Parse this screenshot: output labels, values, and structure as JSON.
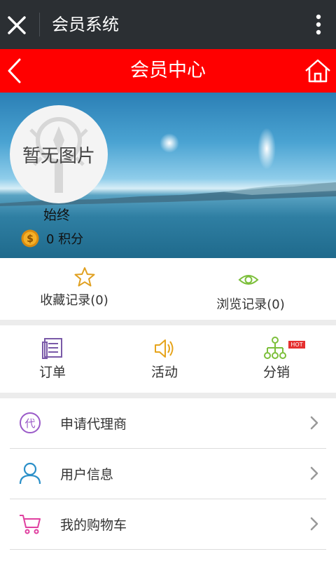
{
  "window": {
    "title": "会员系统"
  },
  "header": {
    "title": "会员中心"
  },
  "profile": {
    "avatar_placeholder": "暂无图片",
    "username": "始终",
    "points_text": "0 积分"
  },
  "records": [
    {
      "label": "收藏记录(0)",
      "icon": "star-icon"
    },
    {
      "label": "浏览记录(0)",
      "icon": "eye-icon"
    }
  ],
  "functions": [
    {
      "label": "订单",
      "icon": "order-document-icon"
    },
    {
      "label": "活动",
      "icon": "speaker-icon"
    },
    {
      "label": "分销",
      "icon": "distribution-tree-icon",
      "badge": "HOT"
    }
  ],
  "menu": [
    {
      "label": "申请代理商",
      "icon": "agent-dai-icon"
    },
    {
      "label": "用户信息",
      "icon": "user-icon"
    },
    {
      "label": "我的购物车",
      "icon": "cart-icon"
    }
  ],
  "colors": {
    "topbar": "#2b2f33",
    "header": "#ff0000",
    "star": "#e0a020",
    "eye": "#7cbf3a",
    "order": "#7a5aa8",
    "speaker": "#e6a41c",
    "tree": "#7cbf3a",
    "agent": "#9a5ac8",
    "user": "#2a8fc8",
    "cart": "#e040a0"
  }
}
